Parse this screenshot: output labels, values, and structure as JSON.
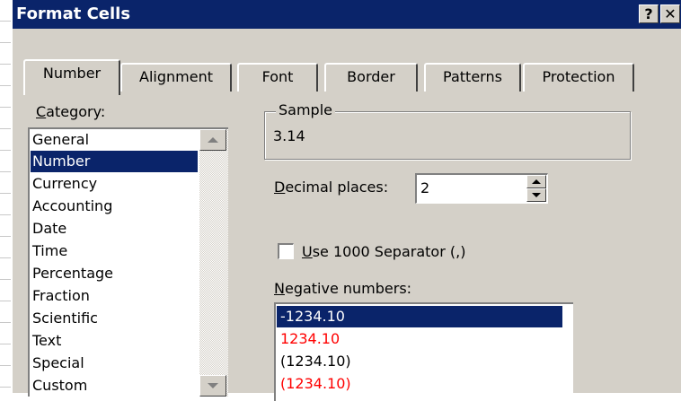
{
  "window": {
    "title": "Format Cells",
    "help_button": "?",
    "close_button": "✕"
  },
  "tabs": [
    {
      "label": "Number",
      "active": true
    },
    {
      "label": "Alignment",
      "active": false
    },
    {
      "label": "Font",
      "active": false
    },
    {
      "label": "Border",
      "active": false
    },
    {
      "label": "Patterns",
      "active": false
    },
    {
      "label": "Protection",
      "active": false
    }
  ],
  "category": {
    "label_accel": "C",
    "label_rest": "ategory:",
    "items": [
      "General",
      "Number",
      "Currency",
      "Accounting",
      "Date",
      "Time",
      "Percentage",
      "Fraction",
      "Scientific",
      "Text",
      "Special",
      "Custom"
    ],
    "selected": "Number"
  },
  "sample": {
    "legend": "Sample",
    "value": "3.14"
  },
  "decimal_places": {
    "label_accel": "D",
    "label_rest": "ecimal places:",
    "value": "2"
  },
  "separator": {
    "label_accel": "U",
    "label_rest": "se 1000 Separator (,)",
    "checked": false
  },
  "negative_numbers": {
    "label_accel": "N",
    "label_rest": "egative numbers:",
    "items": [
      {
        "text": "-1234.10",
        "color": "#ffffff",
        "selected": true
      },
      {
        "text": "1234.10",
        "color": "#ff0000",
        "selected": false
      },
      {
        "text": "(1234.10)",
        "color": "#000000",
        "selected": false
      },
      {
        "text": "(1234.10)",
        "color": "#ff0000",
        "selected": false
      }
    ]
  },
  "colors": {
    "titlebar": "#0a246a",
    "dialog_face": "#d4d0c8",
    "selection": "#0a246a",
    "negative_red": "#ff0000"
  }
}
